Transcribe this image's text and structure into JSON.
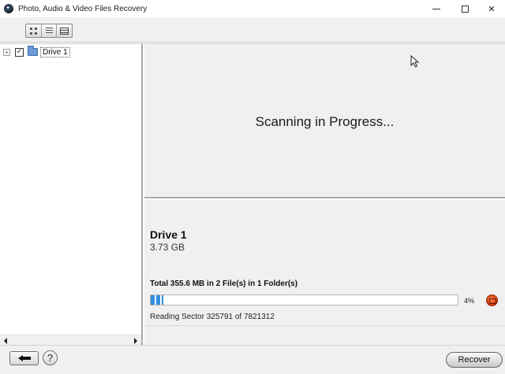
{
  "window": {
    "title": "Photo, Audio & Video Files Recovery",
    "icon": "app-icon"
  },
  "toolbar": {
    "view_buttons": [
      "thumbnails-view-icon",
      "list-view-icon",
      "details-view-icon"
    ]
  },
  "tree": {
    "items": [
      {
        "label": "Drive 1",
        "checked": true,
        "expander": "+",
        "check_glyph": "✓"
      }
    ]
  },
  "scan": {
    "status_text": "Scanning in Progress..."
  },
  "detail": {
    "drive_name": "Drive 1",
    "drive_size": "3.73 GB",
    "total_text": "Total 355.6 MB in 2 File(s) in 1 Folder(s)",
    "progress_fraction": 0.04,
    "progress_label": "4%",
    "reading_text": "Reading Sector  325791 of 7821312"
  },
  "bottom": {
    "help_label": "?",
    "recover_label": "Recover"
  },
  "colors": {
    "progress": "#2f8fe0",
    "stop": "#d8380e",
    "folder": "#6a9bd8"
  }
}
